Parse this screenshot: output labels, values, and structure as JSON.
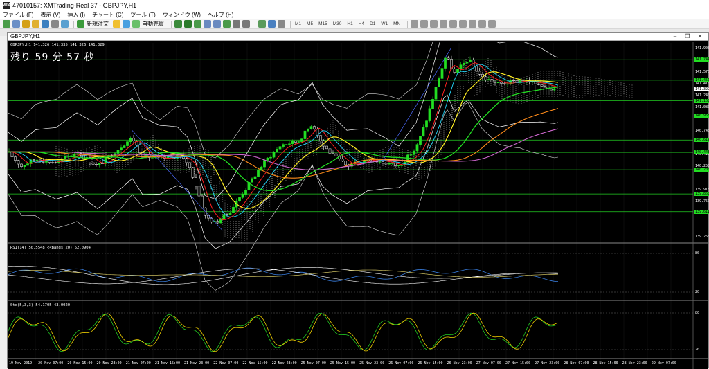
{
  "window": {
    "title": "47010157: XMTrading-Real 37 - GBPJPY,H1",
    "logo_text": "MT4"
  },
  "menu": [
    "ファイル (F)",
    "表示 (V)",
    "挿入 (I)",
    "チャート (C)",
    "ツール (T)",
    "ウィンドウ (W)",
    "ヘルプ (H)"
  ],
  "toolbar": {
    "new_order_label": "新規注文",
    "auto_trade_label": "自動売買",
    "timeframes": [
      "M1",
      "M5",
      "M15",
      "M30",
      "H1",
      "H4",
      "D1",
      "W1",
      "MN"
    ]
  },
  "chart_window": {
    "title": "GBPJPY,H1",
    "info_line": "GBPJPY,H1  141.326 141.335 141.326 141.329",
    "timer": "残り 59 分 57 秒",
    "rsi_label": "RSI(14) 50.5548  <<Bands(20) 52.0904",
    "stoch_label": "Sto(5,3,3) 54.1705 43.0020"
  },
  "price_axis": {
    "labels": [
      "141.905",
      "141.575",
      "141.410",
      "141.240",
      "141.080",
      "140.745",
      "140.415",
      "140.250",
      "139.915",
      "139.750",
      "139.585",
      "139.255"
    ],
    "current_price": "141.329",
    "green_levels": [
      "141.744",
      "141.457",
      "141.168",
      "140.956",
      "140.617",
      "140.443",
      "140.200",
      "139.860",
      "139.611"
    ]
  },
  "rsi_axis": [
    "80",
    "20"
  ],
  "stoch_axis": [
    "80",
    "20"
  ],
  "time_axis": [
    "19 Nov 2019",
    "20 Nov 07:00",
    "20 Nov 15:00",
    "20 Nov 23:00",
    "21 Nov 07:00",
    "21 Nov 15:00",
    "21 Nov 23:00",
    "22 Nov 07:00",
    "22 Nov 15:00",
    "22 Nov 23:00",
    "25 Nov 07:00",
    "25 Nov 15:00",
    "25 Nov 23:00",
    "26 Nov 07:00",
    "26 Nov 15:00",
    "26 Nov 23:00",
    "27 Nov 07:00",
    "27 Nov 15:00",
    "27 Nov 23:00",
    "28 Nov 07:00",
    "28 Nov 15:00",
    "28 Nov 23:00",
    "29 Nov 07:00"
  ],
  "colors": {
    "candle_up": "#22dd22",
    "level_line": "#22cc22",
    "ema_fast": "#ff2020",
    "ema_cyan": "#22ccee",
    "ema_yellow": "#ffee22",
    "ema_green": "#22dd22",
    "ema_orange": "#ff8c1a",
    "ema_violet": "#cc66cc"
  }
}
